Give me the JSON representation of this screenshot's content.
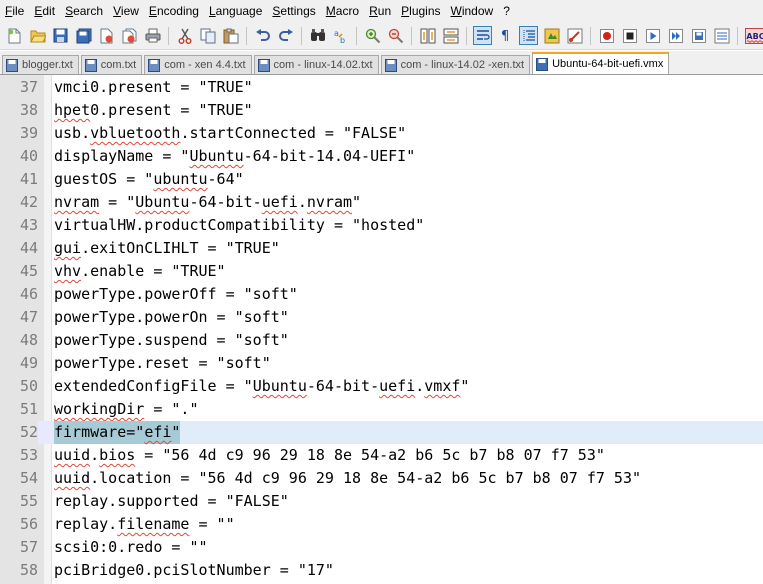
{
  "menu": {
    "items": [
      "File",
      "Edit",
      "Search",
      "View",
      "Encoding",
      "Language",
      "Settings",
      "Macro",
      "Run",
      "Plugins",
      "Window",
      "?"
    ]
  },
  "toolbar": {
    "icons": [
      "new-file-icon",
      "open-file-icon",
      "save-icon",
      "save-all-icon",
      "close-icon",
      "close-all-icon",
      "print-icon",
      "cut-icon",
      "copy-icon",
      "paste-icon",
      "undo-icon",
      "redo-icon",
      "find-icon",
      "replace-icon",
      "zoom-in-icon",
      "zoom-out-icon",
      "sync-vertical-icon",
      "sync-horizontal-icon",
      "word-wrap-icon",
      "show-all-chars-icon",
      "indent-guide-icon",
      "user-lang-icon",
      "doc-map-icon",
      "function-list-icon",
      "record-macro-icon",
      "stop-macro-icon",
      "play-macro-icon",
      "play-multiple-icon",
      "save-macro-icon",
      "spell-check-icon"
    ],
    "spellcheck_label": "ABC"
  },
  "tabs": [
    {
      "label": "blogger.txt",
      "active": false
    },
    {
      "label": "com.txt",
      "active": false
    },
    {
      "label": "com - xen 4.4.txt",
      "active": false
    },
    {
      "label": "com - linux-14.02.txt",
      "active": false
    },
    {
      "label": "com - linux-14.02 -xen.txt",
      "active": false
    },
    {
      "label": "Ubuntu-64-bit-uefi.vmx",
      "active": true
    }
  ],
  "editor": {
    "lines": [
      {
        "number": "37",
        "text": "vmci0.present = \"TRUE\""
      },
      {
        "number": "38",
        "text": "hpet0.present = \"TRUE\""
      },
      {
        "number": "39",
        "text": "usb.vbluetooth.startConnected = \"FALSE\""
      },
      {
        "number": "40",
        "text": "displayName = \"Ubuntu-64-bit-14.04-UEFI\""
      },
      {
        "number": "41",
        "text": "guestOS = \"ubuntu-64\""
      },
      {
        "number": "42",
        "text": "nvram = \"Ubuntu-64-bit-uefi.nvram\""
      },
      {
        "number": "43",
        "text": "virtualHW.productCompatibility = \"hosted\""
      },
      {
        "number": "44",
        "text": "gui.exitOnCLIHLT = \"TRUE\""
      },
      {
        "number": "45",
        "text": "vhv.enable = \"TRUE\""
      },
      {
        "number": "46",
        "text": "powerType.powerOff = \"soft\""
      },
      {
        "number": "47",
        "text": "powerType.powerOn = \"soft\""
      },
      {
        "number": "48",
        "text": "powerType.suspend = \"soft\""
      },
      {
        "number": "49",
        "text": "powerType.reset = \"soft\""
      },
      {
        "number": "50",
        "text": "extendedConfigFile = \"Ubuntu-64-bit-uefi.vmxf\""
      },
      {
        "number": "51",
        "text": "workingDir = \".\""
      },
      {
        "number": "52",
        "text": "firmware=\"efi\"",
        "current": true,
        "selected": true
      },
      {
        "number": "53",
        "text": "uuid.bios = \"56 4d c9 96 29 18 8e 54-a2 b6 5c b7 b8 07 f7 53\""
      },
      {
        "number": "54",
        "text": "uuid.location = \"56 4d c9 96 29 18 8e 54-a2 b6 5c b7 b8 07 f7 53\""
      },
      {
        "number": "55",
        "text": "replay.supported = \"FALSE\""
      },
      {
        "number": "56",
        "text": "replay.filename = \"\""
      },
      {
        "number": "57",
        "text": "scsi0:0.redo = \"\""
      },
      {
        "number": "58",
        "text": "pciBridge0.pciSlotNumber = \"17\""
      }
    ]
  },
  "colors": {
    "gutter": "#e4e4e4",
    "current_line": "#e0ecf8",
    "selection": "#a6cad6",
    "active_tab_accent": "#f5a623",
    "spell_squiggle": "#e0483a"
  }
}
